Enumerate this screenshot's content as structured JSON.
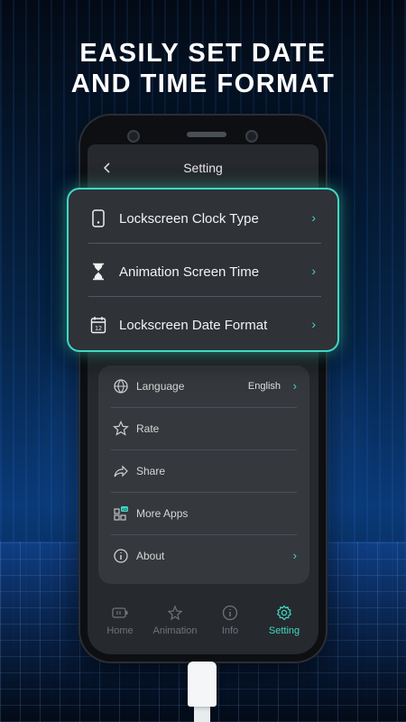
{
  "promo": {
    "headline_line1": "EASILY SET DATE",
    "headline_line2": "AND TIME FORMAT"
  },
  "screen": {
    "title": "Setting",
    "back_icon": "chevron-left-icon"
  },
  "highlight_card": {
    "items": [
      {
        "label": "Lockscreen Clock Type",
        "icon": "phone-icon"
      },
      {
        "label": "Animation Screen Time",
        "icon": "hourglass-icon"
      },
      {
        "label": "Lockscreen Date Format",
        "icon": "calendar-icon",
        "icon_text": "12"
      }
    ]
  },
  "settings_list": {
    "items": [
      {
        "label": "Language",
        "value": "English",
        "icon": "globe-icon"
      },
      {
        "label": "Rate",
        "icon": "star-icon"
      },
      {
        "label": "Share",
        "icon": "share-icon"
      },
      {
        "label": "More Apps",
        "icon": "apps-icon",
        "badge": "AD"
      },
      {
        "label": "About",
        "icon": "info-icon"
      }
    ]
  },
  "tabbar": {
    "tabs": [
      {
        "label": "Home",
        "icon": "battery-icon",
        "active": false
      },
      {
        "label": "Animation",
        "icon": "sparkle-star-icon",
        "active": false
      },
      {
        "label": "Info",
        "icon": "info-icon",
        "active": false
      },
      {
        "label": "Setting",
        "icon": "gear-icon",
        "active": true
      }
    ]
  },
  "colors": {
    "accent": "#3fd9c4",
    "card_bg": "#2f3237",
    "screen_bg": "#26292d"
  }
}
